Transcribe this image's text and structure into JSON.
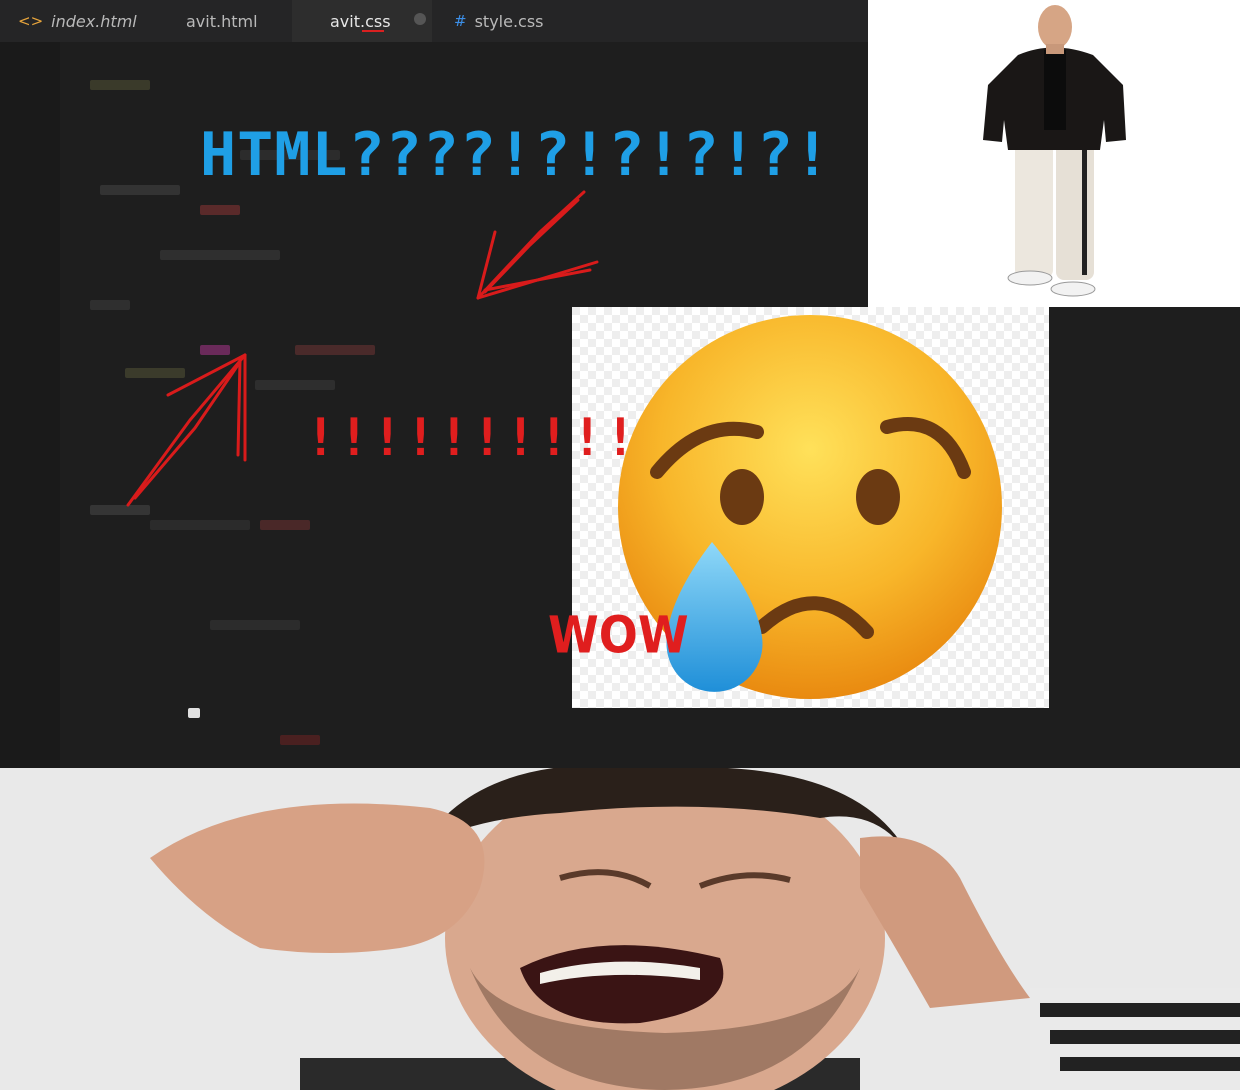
{
  "tabs": [
    {
      "label": "index.html",
      "icon": "code-icon",
      "glyph": "<>",
      "icon_color": "#e8a53c"
    },
    {
      "label": "avit.html",
      "icon": "",
      "glyph": ""
    },
    {
      "label": "avit.css",
      "icon": "",
      "glyph": ""
    },
    {
      "label": "style.css",
      "icon": "hash-icon",
      "glyph": "#",
      "icon_color": "#3c8fe8"
    }
  ],
  "captions": {
    "html_question": "HTML????!?!?!?!?!",
    "exclamations": "!!!!!!!!!!",
    "wow": "WOW"
  },
  "colors": {
    "blue_text": "#1f9fe6",
    "red_text": "#e01e1e",
    "editor_bg": "#1e1e1e"
  }
}
